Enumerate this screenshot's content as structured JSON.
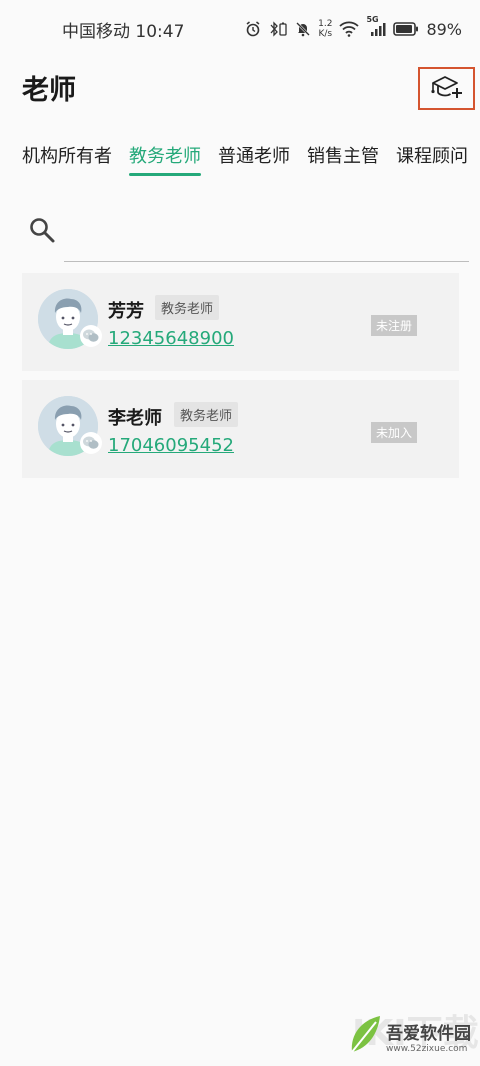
{
  "status_bar": {
    "carrier": "中国移动",
    "time": "10:47",
    "net_speed_top": "1.2",
    "net_speed_bottom": "K/s",
    "signal_tag": "5G",
    "battery": "89%"
  },
  "header": {
    "title": "老师",
    "add_icon": "graduation-cap-plus-icon"
  },
  "tabs": [
    {
      "label": "机构所有者",
      "active": false
    },
    {
      "label": "教务老师",
      "active": true
    },
    {
      "label": "普通老师",
      "active": false
    },
    {
      "label": "销售主管",
      "active": false
    },
    {
      "label": "课程顾问",
      "active": false
    }
  ],
  "search": {
    "placeholder": ""
  },
  "teachers": [
    {
      "name": "芳芳",
      "role": "教务老师",
      "phone": "12345648900",
      "status": "未注册"
    },
    {
      "name": "李老师",
      "role": "教务老师",
      "phone": "17046095452",
      "status": "未加入"
    }
  ],
  "watermark": {
    "title": "吾爱软件园",
    "url": "www.52zixue.com",
    "bg_text": "IKI下载"
  },
  "colors": {
    "accent": "#25a97a",
    "highlight_border": "#d4542f"
  }
}
